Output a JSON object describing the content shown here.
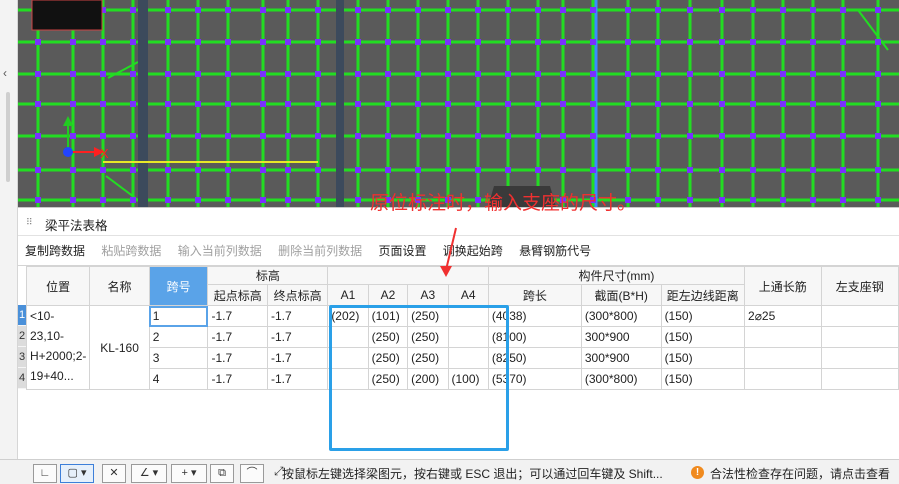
{
  "annotation": {
    "callout_text": "原位标注时，输入支座的尺寸。",
    "color": "#f03030",
    "box_color": "#2aa0e8"
  },
  "viewport": {
    "background": "#5a5a5a",
    "grid_color": "#22dd22",
    "node_color": "#7a30ff",
    "axis_x_label": "X",
    "axis_x_color": "#ff2020",
    "axis_y_color": "#22cc22",
    "beam_highlight_color": "#e8e828",
    "blue_line_color": "#3a8cff",
    "column_color": "#3c4a5c"
  },
  "panel": {
    "title": "梁平法表格",
    "toolbar": [
      {
        "label": "复制跨数据",
        "enabled": true
      },
      {
        "label": "粘贴跨数据",
        "enabled": false
      },
      {
        "label": "输入当前列数据",
        "enabled": false
      },
      {
        "label": "删除当前列数据",
        "enabled": false
      },
      {
        "label": "页面设置",
        "enabled": true
      },
      {
        "label": "调换起始跨",
        "enabled": true
      },
      {
        "label": "悬臂钢筋代号",
        "enabled": true
      }
    ]
  },
  "table": {
    "headers": {
      "position": "位置",
      "name": "名称",
      "span_no": "跨号",
      "elevation": "标高",
      "start_elev": "起点标高",
      "end_elev": "终点标高",
      "a1": "A1",
      "a2": "A2",
      "a3": "A3",
      "a4": "A4",
      "member_size": "构件尺寸(mm)",
      "span_len": "跨长",
      "section": "截面(B*H)",
      "left_edge_dist": "距左边线距离",
      "top_through": "上通长筋",
      "left_support": "左支座钢"
    },
    "position_value": "<10-23,10-H+2000;2-19+40...",
    "name_value": "KL-160",
    "top_through_value": "2⌀25",
    "rows": [
      {
        "num": "1",
        "span": "1",
        "start": "-1.7",
        "end": "-1.7",
        "a1": "(202)",
        "a2": "(101)",
        "a3": "(250)",
        "a4": "",
        "span_len": "(4038)",
        "section": "(300*800)",
        "dist": "(150)"
      },
      {
        "num": "2",
        "span": "2",
        "start": "-1.7",
        "end": "-1.7",
        "a1": "",
        "a2": "(250)",
        "a3": "(250)",
        "a4": "",
        "span_len": "(8100)",
        "section": "300*900",
        "dist": "(150)"
      },
      {
        "num": "3",
        "span": "3",
        "start": "-1.7",
        "end": "-1.7",
        "a1": "",
        "a2": "(250)",
        "a3": "(250)",
        "a4": "",
        "span_len": "(8250)",
        "section": "300*900",
        "dist": "(150)"
      },
      {
        "num": "4",
        "span": "4",
        "start": "-1.7",
        "end": "-1.7",
        "a1": "",
        "a2": "(250)",
        "a3": "(200)",
        "a4": "(100)",
        "span_len": "(5370)",
        "section": "(300*800)",
        "dist": "(150)"
      }
    ]
  },
  "statusbar": {
    "tool_buttons": [
      "line-tool",
      "rect-tool",
      "cross-tool",
      "angle-tool",
      "insert-tool",
      "copy-tool",
      "arc-tool"
    ],
    "message": "按鼠标左键选择梁图元，按右键或 ESC 退出；可以通过回车键及 Shift...",
    "warning_icon": "warning-icon",
    "warning": "合法性检查存在问题，请点击查看"
  }
}
